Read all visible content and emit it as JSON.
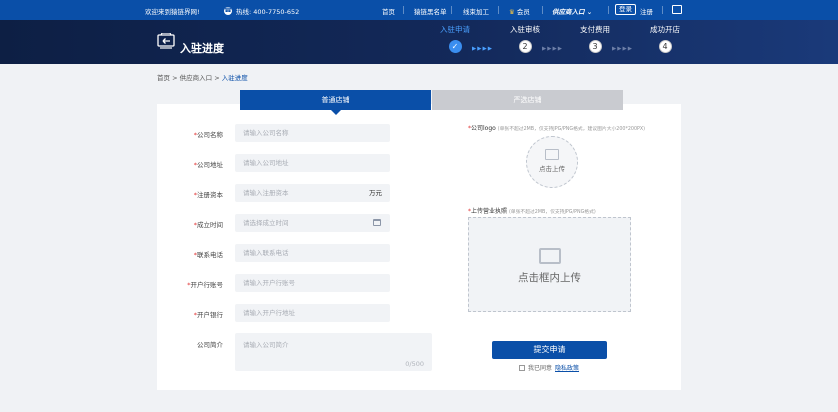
{
  "topbar": {
    "welcome": "欢迎来到猿链界网!",
    "hotline": "热线: 400-7750-652",
    "nav": [
      "首页",
      "猿链黑名单",
      "线束加工"
    ],
    "member": "会员",
    "supplier_entry": "供应商入口",
    "login": "登录",
    "register": "注册"
  },
  "header": {
    "title": "入驻进度",
    "steps": [
      {
        "label": "入驻申请",
        "mark": "✓"
      },
      {
        "label": "入驻审核",
        "mark": "2"
      },
      {
        "label": "支付费用",
        "mark": "3"
      },
      {
        "label": "成功开店",
        "mark": "4"
      }
    ]
  },
  "breadcrumb": {
    "home": "首页",
    "sep": ">",
    "supplier": "供应商入口",
    "current": "入驻进度"
  },
  "tabs": {
    "normal": "普通店铺",
    "premium": "严选店铺"
  },
  "form": {
    "fields": [
      {
        "label": "公司名称",
        "placeholder": "请输入公司名称",
        "required": true
      },
      {
        "label": "公司地址",
        "placeholder": "请输入公司地址",
        "required": true
      },
      {
        "label": "注册资本",
        "placeholder": "请输入注册资本",
        "required": true,
        "unit": "万元"
      },
      {
        "label": "成立时间",
        "placeholder": "请选择成立时间",
        "required": true
      },
      {
        "label": "联系电话",
        "placeholder": "请输入联系电话",
        "required": true
      },
      {
        "label": "开户行账号",
        "placeholder": "请输入开户行账号",
        "required": true
      },
      {
        "label": "开户银行",
        "placeholder": "请输入开户行地址",
        "required": true
      }
    ],
    "intro_label": "公司简介",
    "intro_placeholder": "请输入公司简介",
    "intro_count": "0/500",
    "required_mark": "*"
  },
  "uploads": {
    "logo_label": "公司logo",
    "logo_note": "(单张不超过2MB，仅支持JPG/PNG格式，建议图片大小200*200PX)",
    "logo_text": "点击上传",
    "license_label": "上传营业执照",
    "license_note": "(单张不超过2MB，仅支持JPG/PNG格式)",
    "license_text": "点击框内上传"
  },
  "submit_label": "提交申请",
  "agree_text": "我已同意",
  "privacy_link": "隐私政策",
  "colors": {
    "primary": "#0a4fa8",
    "header_bg": "#13295a",
    "required": "#e03030"
  }
}
